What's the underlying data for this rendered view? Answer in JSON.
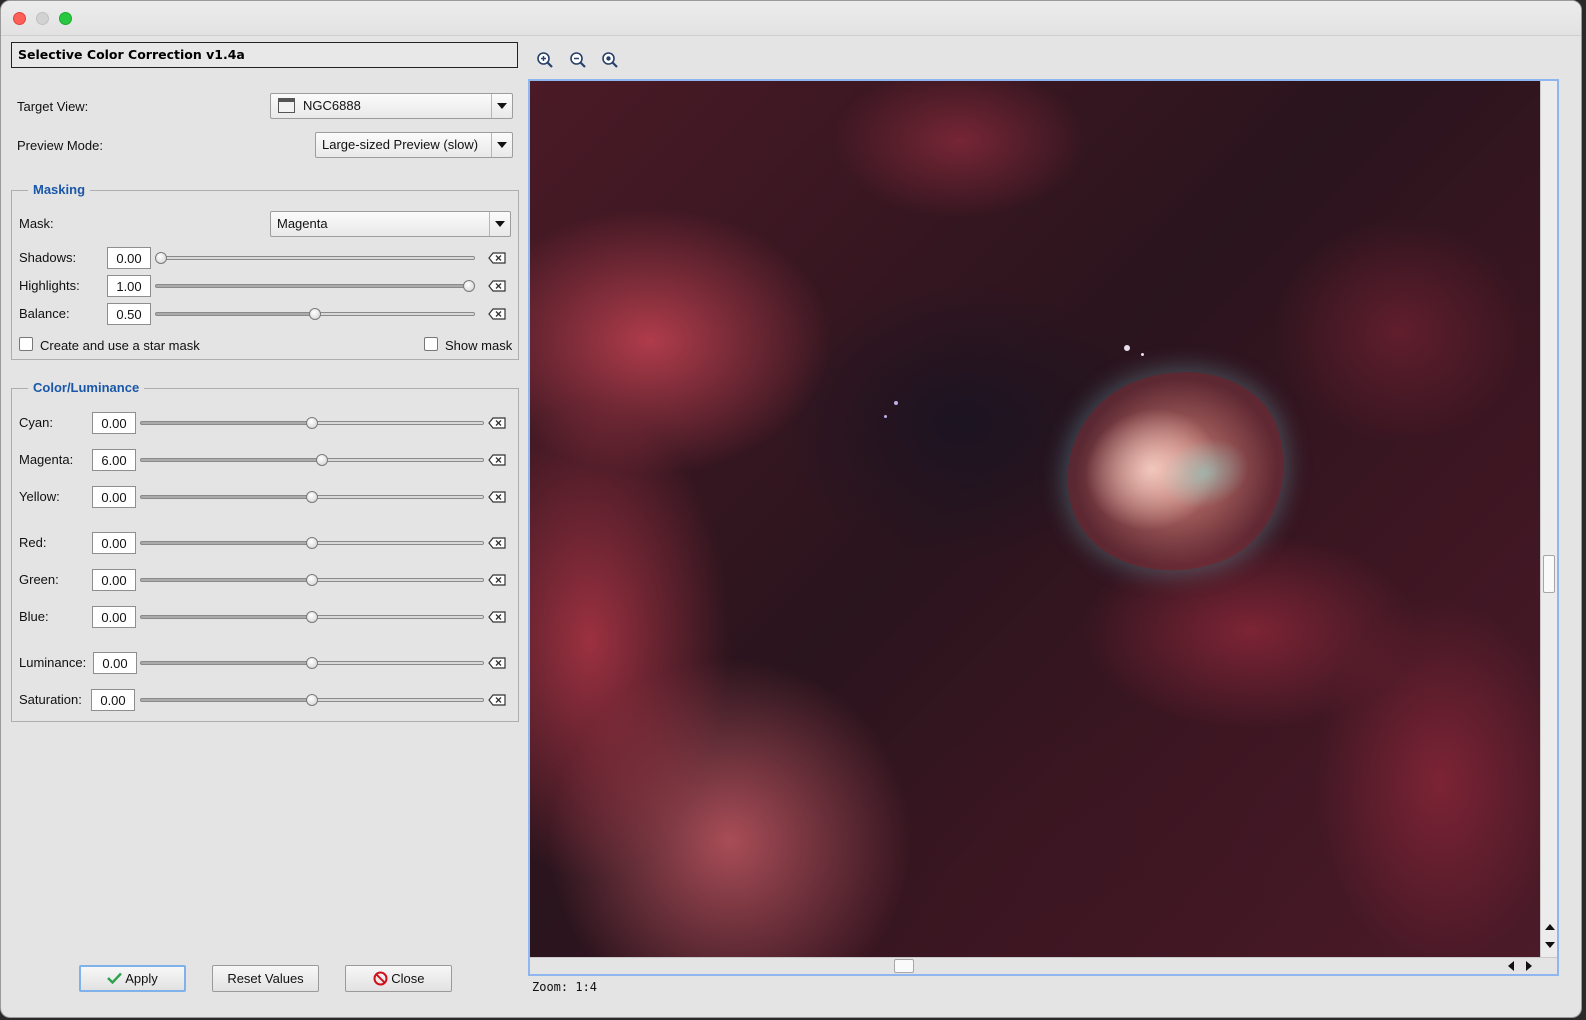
{
  "window": {
    "title_panel": "Selective Color Correction v1.4a"
  },
  "target_view": {
    "label": "Target View:",
    "value": "NGC6888"
  },
  "preview_mode": {
    "label": "Preview Mode:",
    "value": "Large-sized Preview (slow)"
  },
  "masking": {
    "title": "Masking",
    "mask_label": "Mask:",
    "mask_value": "Magenta",
    "sliders": [
      {
        "label": "Shadows:",
        "value": "0.00",
        "level": 0.0
      },
      {
        "label": "Highlights:",
        "value": "1.00",
        "level": 1.0
      },
      {
        "label": "Balance:",
        "value": "0.50",
        "level": 0.5
      }
    ],
    "star_mask_label": "Create and use a star mask",
    "star_mask_checked": false,
    "show_mask_label": "Show mask",
    "show_mask_checked": false
  },
  "color_luminance": {
    "title": "Color/Luminance",
    "sliders": [
      {
        "label": "Cyan:",
        "value": "0.00",
        "level": 0.5
      },
      {
        "label": "Magenta:",
        "value": "6.00",
        "level": 0.53
      },
      {
        "label": "Yellow:",
        "value": "0.00",
        "level": 0.5
      },
      {
        "label": "Red:",
        "value": "0.00",
        "level": 0.5
      },
      {
        "label": "Green:",
        "value": "0.00",
        "level": 0.5
      },
      {
        "label": "Blue:",
        "value": "0.00",
        "level": 0.5
      },
      {
        "label": "Luminance:",
        "value": "0.00",
        "level": 0.5
      },
      {
        "label": "Saturation:",
        "value": "0.00",
        "level": 0.5
      }
    ]
  },
  "buttons": {
    "apply": "Apply",
    "reset": "Reset Values",
    "close": "Close"
  },
  "preview": {
    "zoom_label": "Zoom: 1:4",
    "toolbar": [
      "zoom-in-icon",
      "zoom-out-icon",
      "zoom-fit-icon"
    ]
  },
  "colors": {
    "accent_blue": "#1a57a8",
    "focus_ring": "#7fb1ea",
    "close_red": "#d0111b",
    "apply_green": "#2da24a"
  }
}
